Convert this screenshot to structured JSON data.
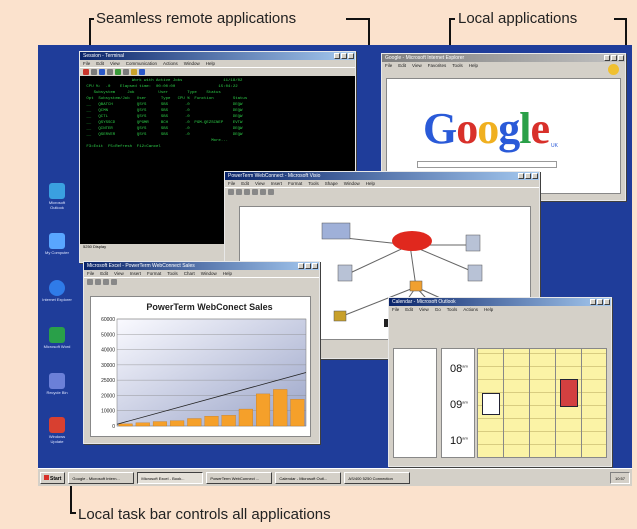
{
  "callouts": {
    "seamless": "Seamless remote applications",
    "local_apps": "Local applications",
    "taskbar": "Local task bar controls all applications"
  },
  "desktop_icons": [
    {
      "label": "Microsoft Outlook",
      "icon": "outlook-icon",
      "color": "#3aa0e0"
    },
    {
      "label": "My Computer",
      "icon": "computer-icon",
      "color": "#59a6ff"
    },
    {
      "label": "Internet Explorer",
      "icon": "ie-icon",
      "color": "#2f7be8"
    },
    {
      "label": "Microsoft Word",
      "icon": "word-icon",
      "color": "#29a049"
    },
    {
      "label": "Recycle Bin",
      "icon": "recycle-icon",
      "color": "#6b80d8"
    },
    {
      "label": "Windows Update",
      "icon": "update-icon",
      "color": "#d84030"
    }
  ],
  "terminal_window": {
    "title": "Session - Terminal",
    "menu": [
      "File",
      "Edit",
      "View",
      "Communication",
      "Actions",
      "Window",
      "Help"
    ],
    "lines": [
      "                    Work with Active Jobs                 11/18/02",
      " CPU %:  .0    Elapsed time:  00:00:00                  15:04:22",
      "    Subsystem     Job          User        Type    Status",
      "",
      " Opt  Subsystem/Job   User      Type   CPU %  Function        Status",
      " __   QBATCH          QSYS      SBS       .0                  DEQW",
      " __   QCMN            QSYS      SBS       .0                  DEQW",
      " __   QCTL            QSYS      SBS       .0                  DEQW",
      " __   QSYSSCD         QPGMR     BCH       .0  PGM-QEZSCNEP    EVTW",
      " __   QINTER          QSYS      SBS       .0                  DEQW",
      " __   QSERVER         QSYS      SBS       .0                  DEQW",
      "",
      "                                                     More...",
      " F3=Exit  F5=Refresh  F12=Cancel"
    ],
    "status": "5250 Display"
  },
  "browser_window": {
    "title": "Google - Microsoft Internet Explorer",
    "menu": [
      "File",
      "Edit",
      "View",
      "Favorites",
      "Tools",
      "Help"
    ],
    "logo": "Google",
    "logo_suffix": "UK"
  },
  "visio_window": {
    "title": "PowerTerm WebConnect - Microsoft Visio",
    "menu": [
      "File",
      "Edit",
      "View",
      "Insert",
      "Format",
      "Tools",
      "Shape",
      "Window",
      "Help"
    ]
  },
  "excel_window": {
    "title": "Microsoft Excel - PowerTerm WebConnect Sales",
    "menu": [
      "File",
      "Edit",
      "View",
      "Insert",
      "Format",
      "Tools",
      "Chart",
      "Window",
      "Help"
    ]
  },
  "outlook_window": {
    "title": "Calendar - Microsoft Outlook",
    "menu": [
      "File",
      "Edit",
      "View",
      "Go",
      "Tools",
      "Actions",
      "Help"
    ],
    "times": [
      "08",
      "09",
      "10"
    ],
    "time_suffix": "am"
  },
  "chart_data": {
    "type": "bar",
    "title": "PowerTerm WebConect Sales",
    "yticks": [
      "60000",
      "50000",
      "40000",
      "30000",
      "25000",
      "20000",
      "10000",
      "0"
    ],
    "values": [
      1200,
      1800,
      2500,
      3000,
      4200,
      5500,
      6000,
      9500,
      18000,
      20500,
      15000
    ],
    "trend": [
      1000,
      30000
    ],
    "ylim": [
      0,
      60000
    ],
    "bar_color": "#f5a02a",
    "grid": true
  },
  "taskbar": {
    "start": "Start",
    "buttons": [
      "Google - Microsoft Intern...",
      "Microsoft Excel - Book...",
      "PowerTerm WebConnect ...",
      "Calendar - Microsoft Outl...",
      "AS/400 5250 Connection"
    ],
    "active_index": 1,
    "clock": "10:57"
  }
}
